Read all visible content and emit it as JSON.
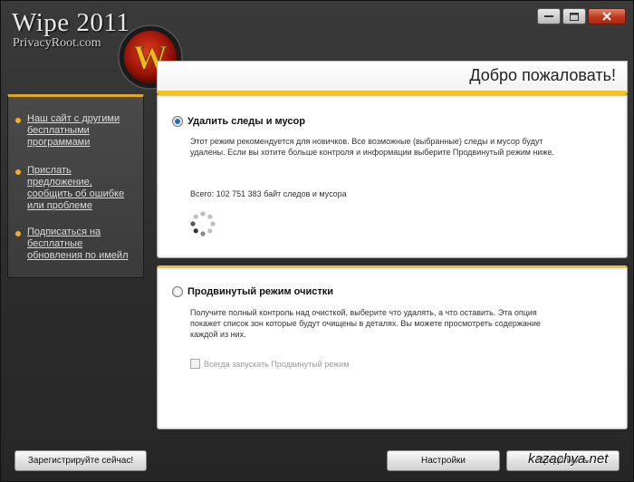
{
  "app": {
    "title": "Wipe 2011",
    "subtitle": "PrivacyRoot.com",
    "logo_letter": "W"
  },
  "header": {
    "welcome": "Добро пожаловать!"
  },
  "sidebar": {
    "items": [
      {
        "label": "Наш сайт с другими бесплатными программами"
      },
      {
        "label": "Прислать предложение, сообщить об ошибке или проблеме"
      },
      {
        "label": "Подписаться на бесплатные обновления по имейл"
      }
    ]
  },
  "simple_mode": {
    "label": "Удалить следы и мусор",
    "selected": true,
    "description": "Этот режим рекомендуется для новичков. Все возможные (выбранные) следы и мусор будут удалены. Если вы хотите больше контроля и информации выберите Продвинутый режим ниже.",
    "total": "Всего: 102 751 383 байт следов и мусора"
  },
  "advanced_mode": {
    "label": "Продвинутый режим очистки",
    "selected": false,
    "description": "Получите полный контроль над очисткой, выберите что удалять, а что оставить. Эта опция покажет список зон которые будут очищены в деталях. Вы можете просмотреть содержание каждой из них.",
    "always_label": "Всегда запускать Продвинутый режим",
    "always_checked": false
  },
  "buttons": {
    "register": "Зарегистрируйте сейчас!",
    "settings": "Настройки",
    "continue": "Продолжить"
  },
  "watermark": "kazachya.net",
  "colors": {
    "accent": "#f0c326",
    "window_bg": "#2f2f2f",
    "close": "#c0391c"
  }
}
